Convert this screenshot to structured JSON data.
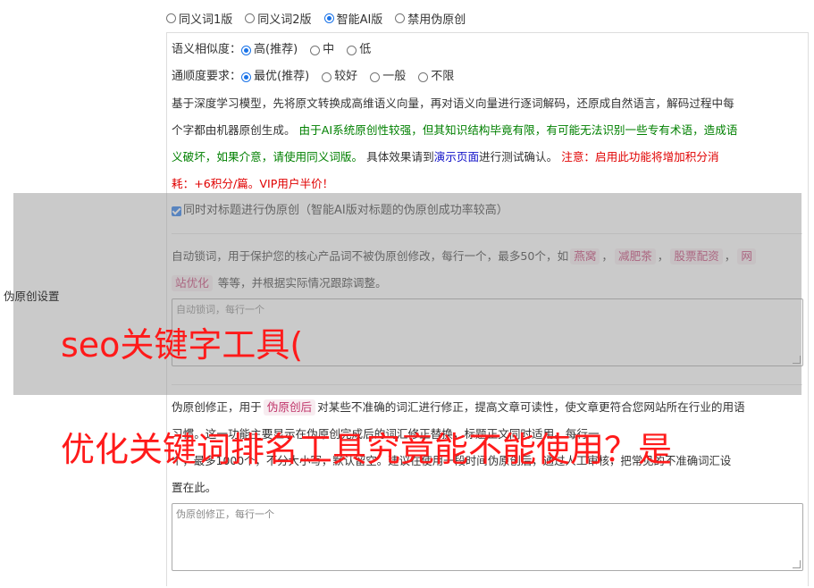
{
  "version_options": [
    {
      "label": "同义词1版",
      "checked": false
    },
    {
      "label": "同义词2版",
      "checked": false
    },
    {
      "label": "智能AI版",
      "checked": true
    },
    {
      "label": "禁用伪原创",
      "checked": false
    }
  ],
  "similarity": {
    "label": "语义相似度：",
    "options": [
      {
        "label": "高(推荐)",
        "checked": true
      },
      {
        "label": "中",
        "checked": false
      },
      {
        "label": "低",
        "checked": false
      }
    ]
  },
  "fluency": {
    "label": "通顺度要求：",
    "options": [
      {
        "label": "最优(推荐)",
        "checked": true
      },
      {
        "label": "较好",
        "checked": false
      },
      {
        "label": "一般",
        "checked": false
      },
      {
        "label": "不限",
        "checked": false
      }
    ]
  },
  "description": {
    "p1": "基于深度学习模型，先将原文转换成高维语义向量，再对语义向量进行逐词解码，还原成自然语言，解码过程中每",
    "p2a": "个字都由机器原创生成。 ",
    "p2b": "由于AI系统原创性较强，但其知识结构毕竟有限，有可能无法识别一些专有术语，造成语",
    "p3a": "义破坏，如果介意，请使用同义词版。",
    "p3b": " 具体效果请到",
    "p3c": "演示页面",
    "p3d": "进行测试确认。 ",
    "p3e": "注意：启用此功能将增加积分消",
    "p4": "耗：+6积分/篇。VIP用户半价！"
  },
  "title_checkbox": {
    "label": "同时对标题进行伪原创（智能AI版对标题的伪原创成功率较高）",
    "checked": true
  },
  "section_label": "伪原创设置",
  "lock_words": {
    "text_a": "自动锁词，用于保护您的核心产品词不被伪原创修改，每行一个，最多50个，如",
    "tags": [
      "燕窝",
      "减肥茶",
      "股票配资",
      "网"
    ],
    "text_b_tag": "站优化",
    "text_b": " 等等，并根据实际情况跟踪调整。",
    "placeholder": "自动锁词，每行一个"
  },
  "correction": {
    "text_a": "伪原创修正，用于",
    "tag": "伪原创后",
    "text_b": "对某些不准确的词汇进行修正，提高文章可读性，使文章更符合您网站所在行业的用语",
    "line2": "习惯。这一功能主要显示在伪原创完成后的词汇修正替换，标题正文同时适用。每行一",
    "line3": "个，最多1000个，不分大小写，默认留空。建议在使用一段时间伪原创后，通过人工审核，把常见的不准确词汇设",
    "line4": "置在此。",
    "placeholder": "伪原创修正，每行一个"
  },
  "watermark": {
    "line1": "seo关键字工具(",
    "line2": "优化关键词排名工具究竟能不能使用？是"
  },
  "colors": {
    "accent": "#1a73e8",
    "green": "#008000",
    "red": "#e00000",
    "link": "#1010c8",
    "watermark": "#ff1a1a"
  }
}
